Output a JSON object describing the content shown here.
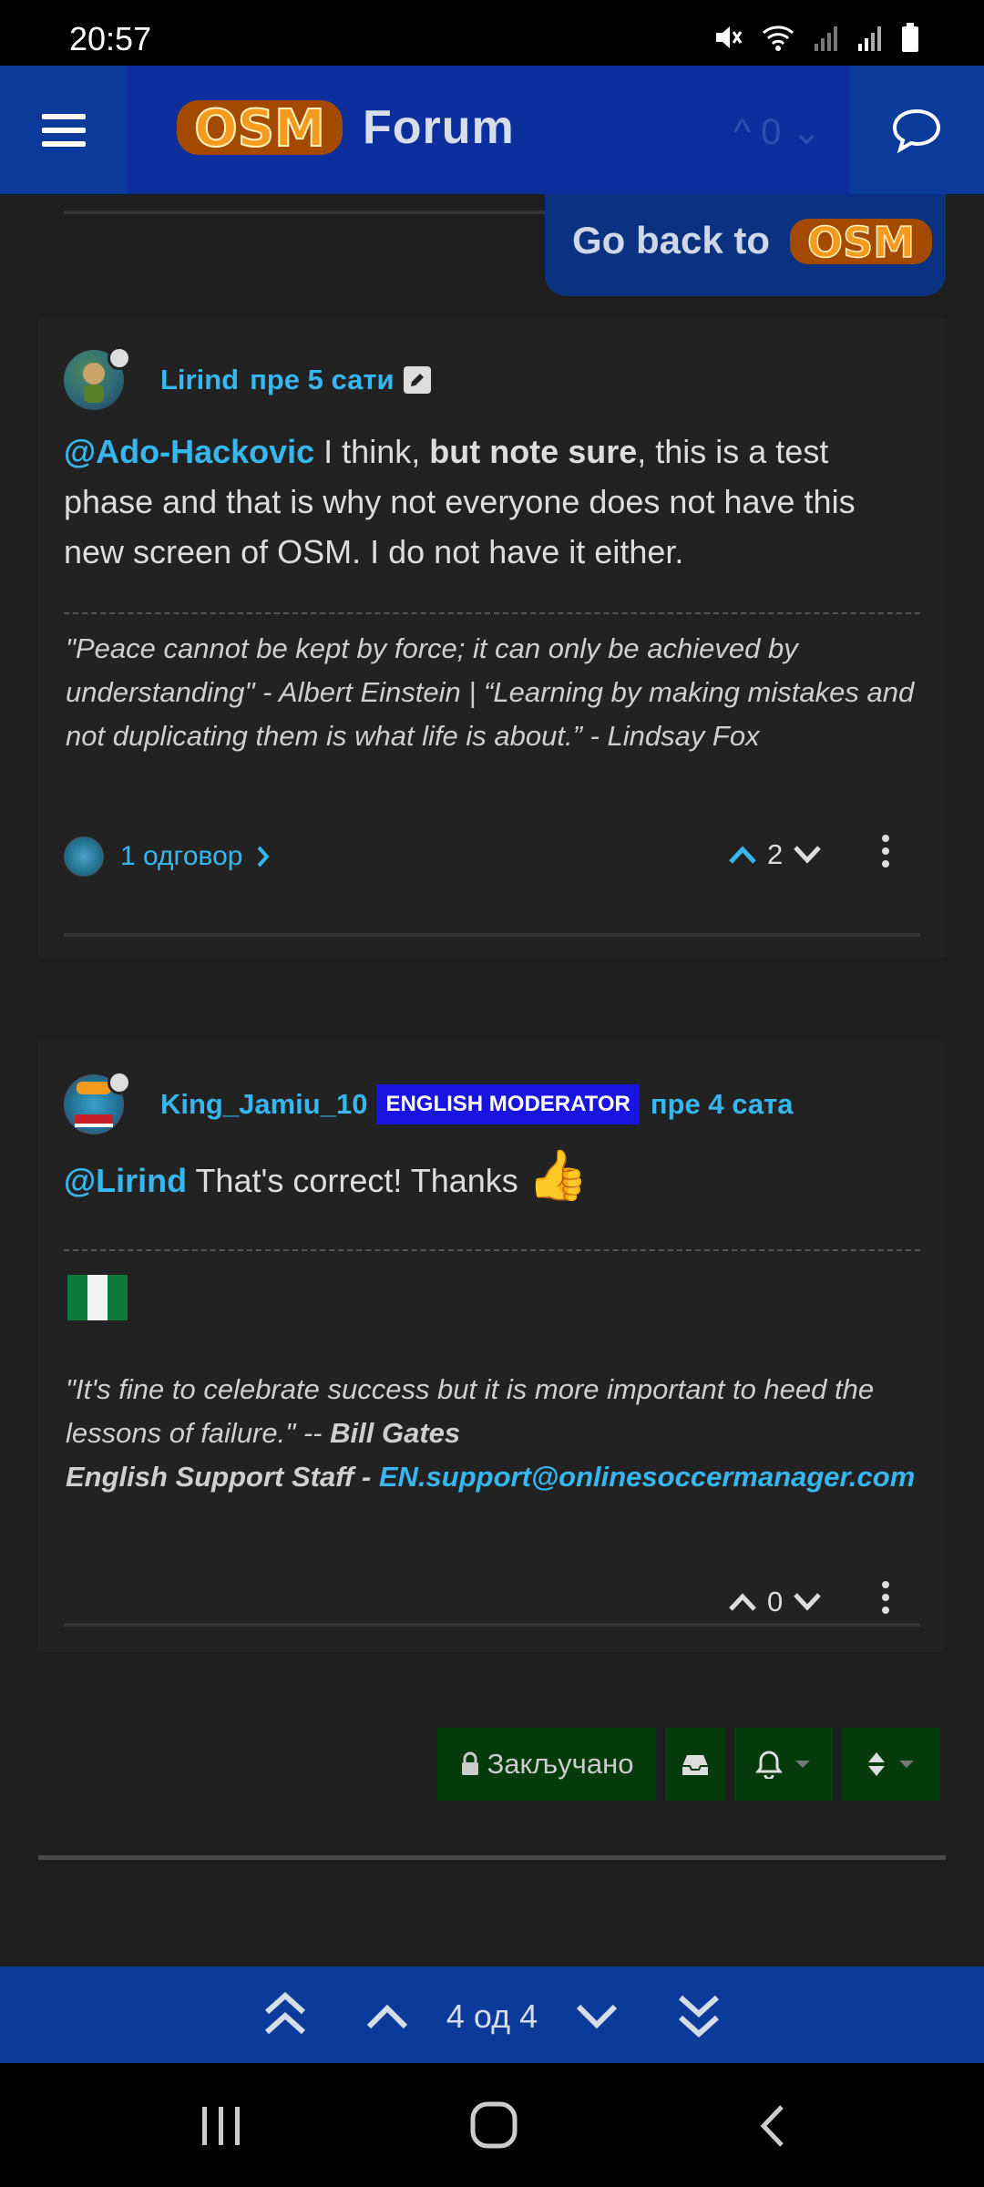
{
  "status_bar": {
    "time": "20:57"
  },
  "header": {
    "logo_text": "OSM",
    "forum_label": "Forum",
    "ghost_text": "^ 0 ⌄"
  },
  "banner": {
    "go_back_label": "Go back to",
    "logo_text": "OSM"
  },
  "posts": [
    {
      "username": "Lirind",
      "time_ago": "пре 5 сати",
      "mention": "@Ado-Hackovic",
      "body_part1": " I think, ",
      "body_bold": "but note sure",
      "body_part2": ", this is a test phase and that is why not everyone does not have this new screen of OSM. I do not have it either.",
      "signature": "\"Peace cannot be kept by force; it can only be achieved by understanding\" - Albert Einstein | “Learning by making mistakes and not duplicating them is what life is about.” - Lindsay Fox",
      "replies_label": "1 одговор",
      "votes": "2"
    },
    {
      "username": "King_Jamiu_10",
      "badge": "ENGLISH MODERATOR",
      "time_ago": "пре 4 сата",
      "mention": "@Lirind",
      "body_text": " That's correct! Thanks ",
      "emoji": "👍",
      "signature_quote": "\"It's fine to celebrate success but it is more important to heed the lessons of failure.\" -- ",
      "signature_author": "Bill Gates",
      "signature_staff": "English Support Staff - ",
      "signature_email": "EN.support@onlinesoccermanager.com",
      "votes": "0"
    }
  ],
  "topic_tools": {
    "locked_label": "Закључано"
  },
  "paginator": {
    "label": "4 од 4"
  },
  "colors": {
    "accent": "#36b7ef",
    "header_blue": "#0a3a9a",
    "tool_green": "#053a0a",
    "badge_blue": "#1a14e0"
  }
}
